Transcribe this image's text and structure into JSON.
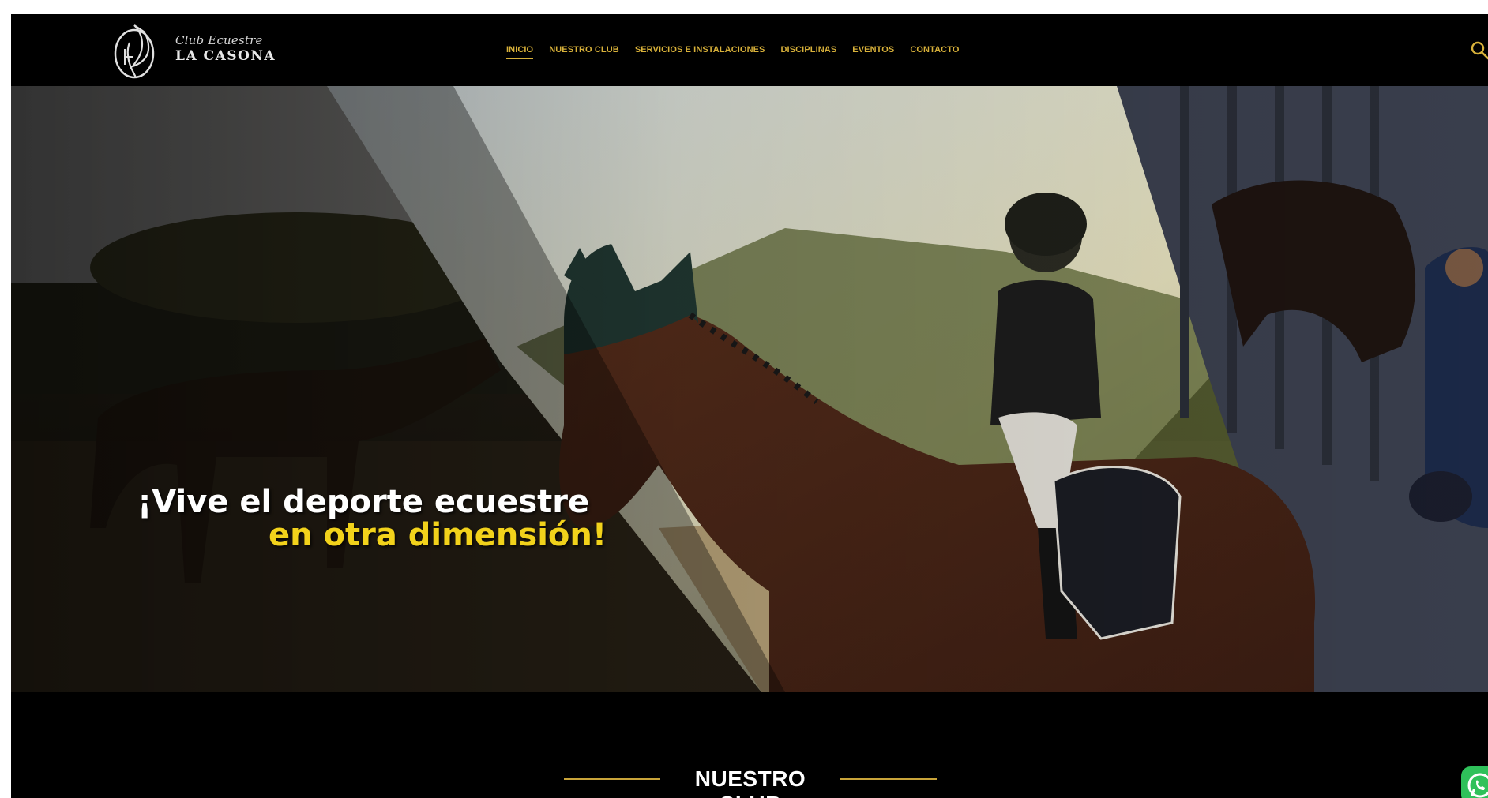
{
  "brand": {
    "name_small": "Club Ecuestre",
    "name_large": "LA CASONA"
  },
  "nav": {
    "items": [
      {
        "label": "INICIO",
        "active": true
      },
      {
        "label": "NUESTRO CLUB",
        "active": false
      },
      {
        "label": "SERVICIOS E INSTALACIONES",
        "active": false
      },
      {
        "label": "DISCIPLINAS",
        "active": false
      },
      {
        "label": "EVENTOS",
        "active": false
      },
      {
        "label": "CONTACTO",
        "active": false
      }
    ],
    "search_icon": "search-icon"
  },
  "hero": {
    "tagline_line1": "¡Vive el deporte ecuestre",
    "tagline_line2": "en otra dimensión!"
  },
  "section": {
    "title": "NUESTRO CLUB"
  },
  "floating": {
    "whatsapp_icon": "whatsapp-icon"
  },
  "colors": {
    "accent_gold": "#d8b13a",
    "tagline_yellow": "#f2d21b",
    "background": "#000000",
    "whatsapp_green": "#2fc15a"
  }
}
